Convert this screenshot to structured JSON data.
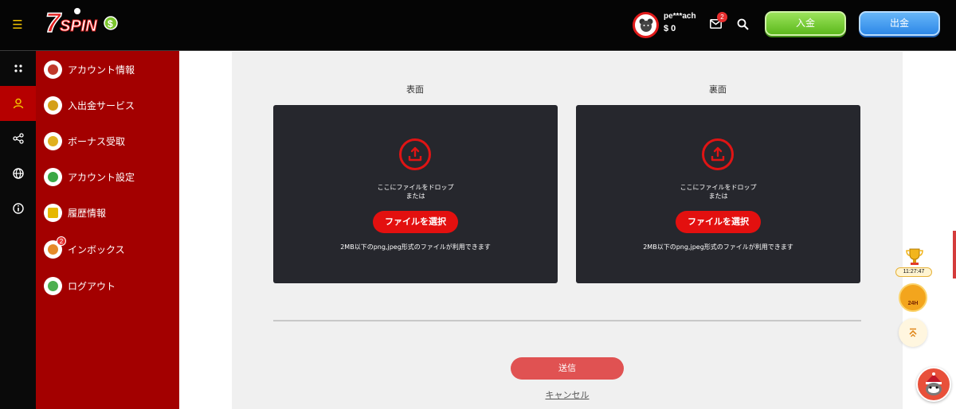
{
  "header": {
    "logo_text": "7SPINS",
    "username": "pe***ach",
    "balance": "$ 0",
    "mail_count": "2",
    "deposit_label": "入金",
    "withdraw_label": "出金"
  },
  "rail": {
    "items": [
      {
        "icon": "grid-icon",
        "active": false
      },
      {
        "icon": "user-icon",
        "active": true
      },
      {
        "icon": "share-icon",
        "active": false
      },
      {
        "icon": "globe-icon",
        "active": false
      },
      {
        "icon": "info-icon",
        "active": false
      }
    ]
  },
  "menu": {
    "items": [
      {
        "label": "アカウント情報",
        "icon": "trophy-icon",
        "color": "#c0392b"
      },
      {
        "label": "入出金サービス",
        "icon": "money-icon",
        "color": "#d4a017"
      },
      {
        "label": "ボーナス受取",
        "icon": "ticket-icon",
        "color": "#e0b020"
      },
      {
        "label": "アカウント設定",
        "icon": "clover-icon",
        "color": "#3aa845"
      },
      {
        "label": "履歴情報",
        "icon": "document-icon",
        "color": "#e6b800"
      },
      {
        "label": "インボックス",
        "icon": "inbox-icon",
        "color": "#e58a2a",
        "badge": "2"
      },
      {
        "label": "ログアウト",
        "icon": "logout-icon",
        "color": "#4caf50"
      }
    ]
  },
  "upload": {
    "front_label": "表面",
    "back_label": "裏面",
    "drop_line1": "ここにファイルをドロップ",
    "drop_line2": "または",
    "pick_label": "ファイルを選択",
    "limit_text": "2MB以下のpng,jpeg形式のファイルが利用できます"
  },
  "form": {
    "submit_label": "送信",
    "cancel_label": "キャンセル"
  },
  "widgets": {
    "timer": "11:27:47",
    "promo_text": "24H"
  },
  "colors": {
    "accent_red": "#a30000",
    "button_red": "#e3100f",
    "deposit_green": "#5cb91c",
    "withdraw_blue": "#2d88e8"
  }
}
